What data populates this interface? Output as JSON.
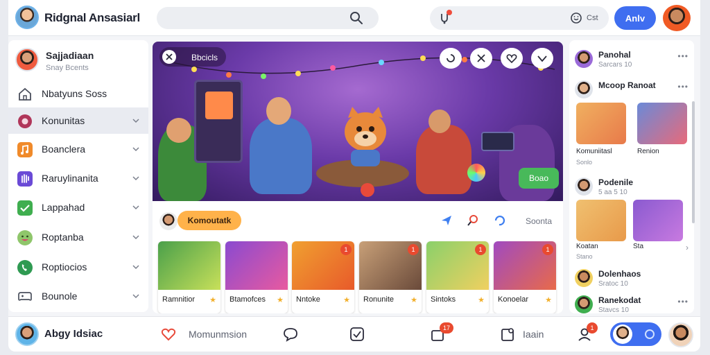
{
  "header": {
    "app_title": "Ridgnal Ansasiarl",
    "notif_label": "Cst",
    "apply_label": "Anlv"
  },
  "sidebar": {
    "profile_name": "Sajjadiaan",
    "profile_sub": "Snay Bcents",
    "items": [
      {
        "label": "Nbatyuns Soss",
        "icon": "home-icon",
        "color": "#6b7080"
      },
      {
        "label": "Konunitas",
        "icon": "community-icon",
        "color": "#b0365a"
      },
      {
        "label": "Boanclera",
        "icon": "music-icon",
        "color": "#f08a2a"
      },
      {
        "label": "Raruylinanita",
        "icon": "hand-icon",
        "color": "#6a4ad6"
      },
      {
        "label": "Lappahad",
        "icon": "check-badge-icon",
        "color": "#3fae4f"
      },
      {
        "label": "Roptanba",
        "icon": "smile-icon",
        "color": "#8fc66b"
      },
      {
        "label": "Roptiocios",
        "icon": "phone-icon",
        "color": "#2f9a52"
      },
      {
        "label": "Bounole",
        "icon": "gamepad-icon",
        "color": "#4a4f5c"
      }
    ]
  },
  "hero": {
    "chip_label": "Bbcicls",
    "badge_label": "Boao"
  },
  "feed": {
    "tag_label": "Komoutatk",
    "right_label": "Soonta",
    "cards": [
      {
        "label": "Ramnitior",
        "badge": ""
      },
      {
        "label": "Btamofces",
        "badge": ""
      },
      {
        "label": "Nntoke",
        "badge": "1"
      },
      {
        "label": "Ronunite",
        "badge": "1"
      },
      {
        "label": "Sintoks",
        "badge": "1"
      },
      {
        "label": "Konoelar",
        "badge": "1"
      }
    ]
  },
  "right": {
    "users": [
      {
        "name": "Panohal",
        "sub": "Sarcars 10"
      },
      {
        "name": "Mcoop Ranoat",
        "sub": ""
      },
      {
        "name": "Podenile",
        "sub": "5 aa 5 10"
      },
      {
        "name": "Dolenhaos",
        "sub": "Sratoc 10"
      },
      {
        "name": "Ranekodat",
        "sub": "Stavcs 10"
      }
    ],
    "thumbs1": [
      {
        "label": "Komuniitasl",
        "sub": "Sonlo"
      },
      {
        "label": "Renion",
        "sub": ""
      }
    ],
    "thumbs2": [
      {
        "label": "Koatan",
        "sub": "Stano"
      },
      {
        "label": "Sta",
        "sub": ""
      }
    ]
  },
  "bottom": {
    "name": "Abgy Idsiac",
    "item1": "Momunmsion",
    "item2": "Iaain",
    "badge1": "17",
    "badge2": "1"
  }
}
